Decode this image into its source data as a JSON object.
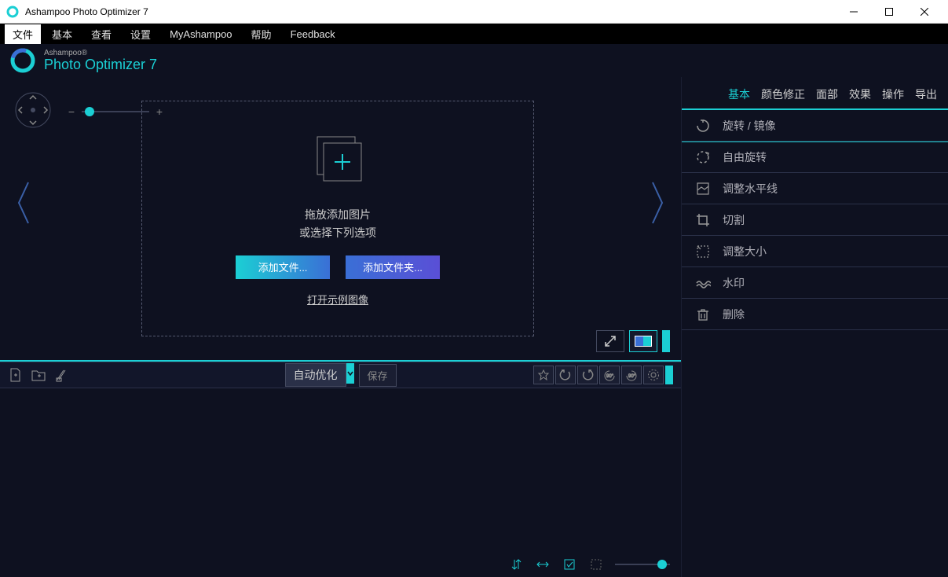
{
  "window": {
    "title": "Ashampoo Photo Optimizer 7"
  },
  "menu": {
    "items": [
      "文件",
      "基本",
      "查看",
      "设置",
      "MyAshampoo",
      "帮助",
      "Feedback"
    ],
    "active_index": 0
  },
  "brand": {
    "top": "Ashampoo®",
    "main": "Photo Optimizer 7"
  },
  "dropzone": {
    "line1": "拖放添加图片",
    "line2": "或选择下列选项",
    "add_files": "添加文件...",
    "add_folder": "添加文件夹...",
    "sample_link": "打开示例图像"
  },
  "toolbar2": {
    "auto_optimize": "自动优化",
    "save": "保存"
  },
  "right_tabs": {
    "items": [
      "基本",
      "颜色修正",
      "面部",
      "效果",
      "操作",
      "导出"
    ],
    "active_index": 0
  },
  "right_list": [
    {
      "icon": "rotate-mirror",
      "label": "旋转 / 镜像"
    },
    {
      "icon": "free-rotate",
      "label": "自由旋转"
    },
    {
      "icon": "horizon",
      "label": "调整水平线"
    },
    {
      "icon": "crop",
      "label": "切割"
    },
    {
      "icon": "resize",
      "label": "调整大小"
    },
    {
      "icon": "watermark",
      "label": "水印"
    },
    {
      "icon": "delete",
      "label": "删除"
    }
  ]
}
